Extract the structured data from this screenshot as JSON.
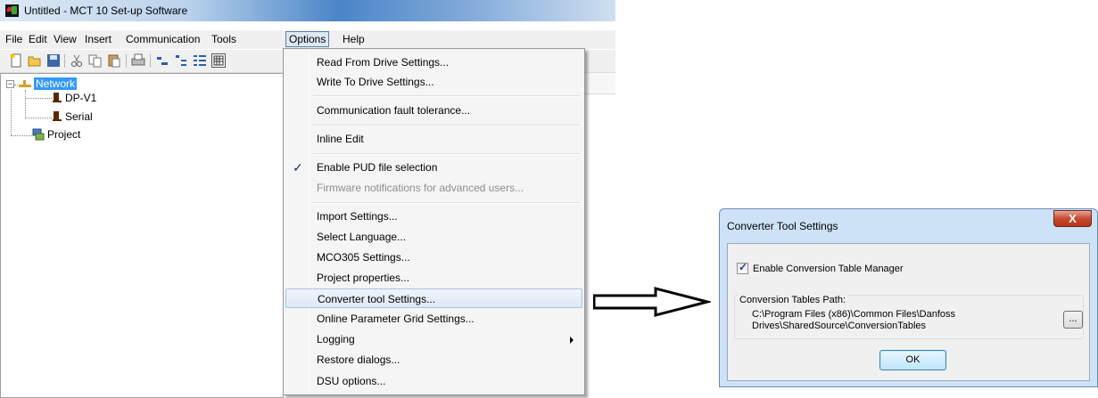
{
  "window": {
    "title": "Untitled - MCT 10 Set-up Software"
  },
  "menubar": {
    "items": [
      "File",
      "Edit",
      "View",
      "Insert",
      "Communication",
      "Tools",
      "Options",
      "Help"
    ],
    "active": "Options"
  },
  "toolbar": {
    "icons": [
      "new-icon",
      "open-icon",
      "save-icon",
      "cut-icon",
      "copy-icon",
      "paste-icon",
      "print-icon",
      "tree-icon-a",
      "tree-icon-b",
      "tree-icon-c",
      "grid-icon"
    ]
  },
  "tree": {
    "network_label": "Network",
    "dpv1_label": "DP-V1",
    "serial_label": "Serial",
    "project_label": "Project"
  },
  "options_menu": {
    "items": [
      {
        "label": "Read From Drive Settings..."
      },
      {
        "label": "Write To Drive Settings..."
      },
      {
        "label": "Communication fault tolerance..."
      },
      {
        "label": "Inline Edit"
      },
      {
        "label": "Enable PUD file selection",
        "checked": true
      },
      {
        "label": "Firmware notifications for advanced users...",
        "disabled": true
      },
      {
        "label": "Import Settings..."
      },
      {
        "label": "Select Language..."
      },
      {
        "label": "MCO305 Settings..."
      },
      {
        "label": "Project properties..."
      },
      {
        "label": "Converter tool Settings...",
        "highlighted": true
      },
      {
        "label": "Online Parameter Grid Settings..."
      },
      {
        "label": "Logging",
        "submenu": true
      },
      {
        "label": "Restore dialogs..."
      },
      {
        "label": "DSU options..."
      }
    ]
  },
  "dialog": {
    "title": "Converter Tool Settings",
    "close_label": "X",
    "enable_label": "Enable Conversion Table Manager",
    "enable_checked": true,
    "path_group_label": "Conversion Tables Path:",
    "path_line1": "C:\\Program Files (x86)\\Common Files\\Danfoss",
    "path_line2": "Drives\\SharedSource\\ConversionTables",
    "browse_label": "...",
    "ok_label": "OK"
  },
  "colors": {
    "selection": "#3399ff",
    "menu_bg": "#f5f5f5",
    "dialog_frame": "#cde2f7"
  }
}
